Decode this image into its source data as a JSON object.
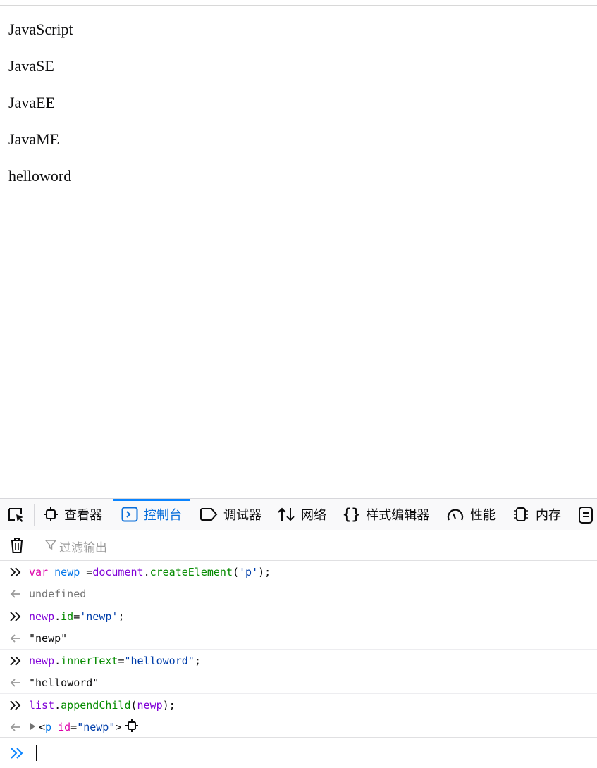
{
  "page": {
    "paragraphs": [
      "JavaScript",
      "JavaSE",
      "JavaEE",
      "JavaME",
      "helloword"
    ]
  },
  "devtools": {
    "tabs": [
      {
        "label": "查看器",
        "icon": "inspector-icon"
      },
      {
        "label": "控制台",
        "icon": "console-icon",
        "active": true
      },
      {
        "label": "调试器",
        "icon": "debugger-icon"
      },
      {
        "label": "网络",
        "icon": "network-icon"
      },
      {
        "label": "样式编辑器",
        "icon": "style-editor-icon"
      },
      {
        "label": "性能",
        "icon": "performance-icon"
      },
      {
        "label": "内存",
        "icon": "memory-icon"
      }
    ],
    "filter_placeholder": "过滤输出",
    "console": {
      "entries": [
        {
          "input": {
            "var_kw": "var",
            "var_name": "newp",
            "assign": " =",
            "obj": "document",
            "dot": ".",
            "method": "createElement",
            "open": "(",
            "arg": "'p'",
            "close": ");"
          },
          "output": "undefined"
        },
        {
          "input": {
            "obj": "newp",
            "dot": ".",
            "prop": "id",
            "eq": "=",
            "val": "'newp'",
            "end": ";"
          },
          "output": "\"newp\""
        },
        {
          "input": {
            "obj": "newp",
            "dot": ".",
            "prop": "innerText",
            "eq": "=",
            "val": "\"helloword\"",
            "end": ";"
          },
          "output": "\"helloword\""
        },
        {
          "input": {
            "obj": "list",
            "dot": ".",
            "method": "appendChild",
            "open": "(",
            "arg": "newp",
            "close": ");"
          },
          "output": {
            "lt": "<",
            "tag": "p",
            "attr_name": "id",
            "eq": "=",
            "attr_val": "\"newp\"",
            "gt": ">"
          }
        }
      ]
    },
    "colors": {
      "accent": "#0a84ff",
      "active_tab_text": "#0a6fdb"
    }
  }
}
